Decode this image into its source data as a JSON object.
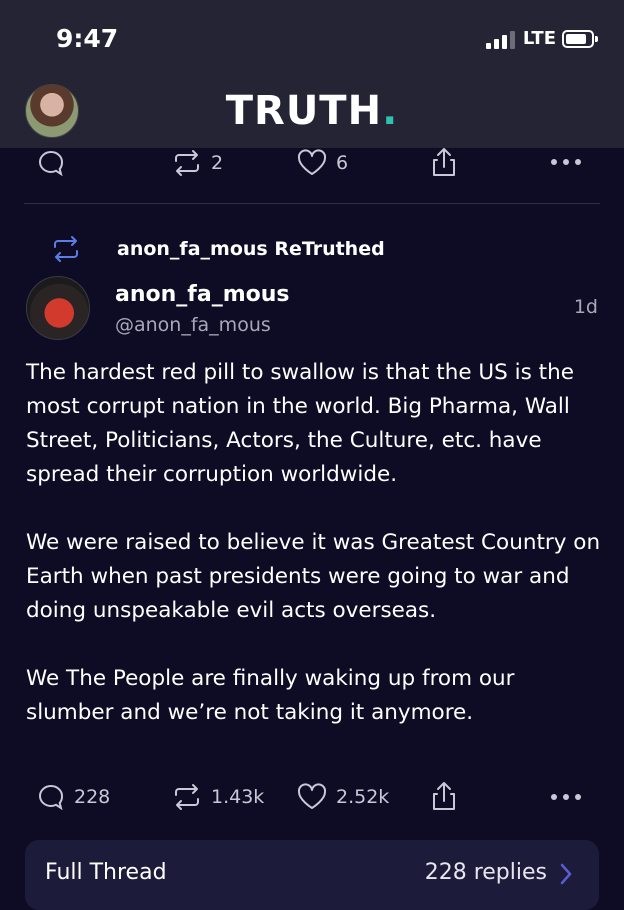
{
  "status_bar": {
    "time": "9:47",
    "network": "LTE"
  },
  "header": {
    "logo_text": "TRUTH",
    "logo_dot": "."
  },
  "previous_post_actions": {
    "retruths": "2",
    "likes": "6"
  },
  "post": {
    "retruth_label": "anon_fa_mous ReTruthed",
    "author_name": "anon_fa_mous",
    "author_handle": "@anon_fa_mous",
    "timestamp": "1d",
    "paragraphs": [
      "The hardest red pill to swallow is that the US is the most corrupt nation in the world. Big Pharma, Wall Street, Politicians, Actors, the Culture, etc. have spread their corruption worldwide.",
      "We were raised to believe it was Greatest Country on Earth when past presidents were going to war and doing unspeakable evil acts overseas.",
      "We The People are finally waking up from our slumber and we’re not taking it anymore."
    ],
    "actions": {
      "replies": "228",
      "retruths": "1.43k",
      "likes": "2.52k"
    }
  },
  "full_thread": {
    "label": "Full Thread",
    "replies": "228 replies"
  },
  "colors": {
    "background": "#0e0b25",
    "header": "#252434",
    "accent": "#30c2b1",
    "link": "#5b5bd6"
  },
  "icons": [
    "reply-icon",
    "retruth-icon",
    "like-icon",
    "share-icon",
    "more-icon",
    "chevron-right-icon"
  ]
}
